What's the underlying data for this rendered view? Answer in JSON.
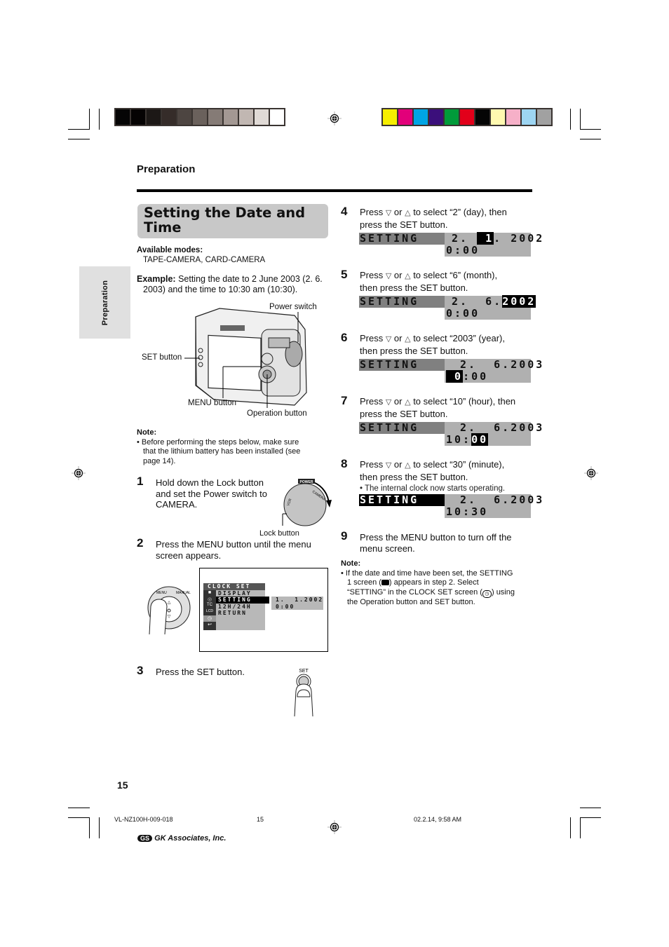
{
  "print_marks": {
    "grayscale_swatches": [
      "#050505",
      "#050303",
      "#1c1816",
      "#352c29",
      "#4d4541",
      "#6a615c",
      "#857b76",
      "#a39893",
      "#c1b7b2",
      "#e0dad6",
      "#ffffff"
    ],
    "color_swatches": [
      "#f6ee00",
      "#e2007a",
      "#00a5e5",
      "#3b0f7b",
      "#009b3a",
      "#e2001a",
      "#050505",
      "#fff9b0",
      "#f6b0c8",
      "#9dd5f2",
      "#a1a1a1"
    ]
  },
  "header": {
    "section": "Preparation",
    "side_tab": "Preparation"
  },
  "title": {
    "line1": "Setting the Date and",
    "line2": "Time"
  },
  "modes": {
    "label": "Available modes:",
    "value": "TAPE-CAMERA, CARD-CAMERA"
  },
  "example": {
    "label": "Example:",
    "line1": " Setting the date to 2 June 2003 (2. 6.",
    "line2": "2003) and the time to 10:30 am (10:30)."
  },
  "camera_figure": {
    "power_switch": "Power switch",
    "set_button": "SET button",
    "menu_button": "MENU button",
    "operation_button": "Operation button"
  },
  "note1": {
    "label": "Note:",
    "lines": [
      "• Before performing the steps below, make sure",
      "that the lithium battery has been installed (see",
      "page 14)."
    ]
  },
  "steps_left": [
    {
      "num": "1",
      "lines": [
        "Hold down the Lock button",
        "and set the Power switch to",
        "CAMERA."
      ]
    },
    {
      "num": "2",
      "lines": [
        "Press the MENU button until the menu",
        "screen appears."
      ]
    },
    {
      "num": "3",
      "lines": [
        "Press the SET button."
      ]
    }
  ],
  "dial_figure": {
    "power": "POWER",
    "camera": "CAMERA",
    "vcr": "VCR",
    "lock_button": "Lock button"
  },
  "menu_screen": {
    "title": "CLOCK SET",
    "items": [
      "DISPLAY",
      "SETTING",
      "12H/24H",
      "RETURN"
    ],
    "selected": "SETTING",
    "side_icons": [
      "camera-icon",
      "card-icon",
      "tc-icon",
      "lcd-icon",
      "clock-icon",
      "return-icon"
    ],
    "side_texts": [
      "",
      "",
      "TC",
      "LCD",
      "",
      ""
    ],
    "date": "1.  1.2002",
    "time": "0:00"
  },
  "hand_dial": {
    "menu": "MENU",
    "manual": "MANUAL"
  },
  "set_figure": {
    "label": "SET"
  },
  "steps_right": [
    {
      "num": "4",
      "pre": "Press ",
      "or": " or ",
      "post": " to select “2” (day), then",
      "line2": "press the SET button.",
      "bullet": "",
      "lcd": {
        "label": "SETTING",
        "label_highlight": false,
        "d1": "2. ",
        "d_hl": " 1",
        "d2": ". 2002",
        "t_pre": "0:00",
        "t_hl": "",
        "t_post": ""
      }
    },
    {
      "num": "5",
      "pre": "Press ",
      "or": " or ",
      "post": " to select “6” (month),",
      "line2": "then press the SET button.",
      "bullet": "",
      "lcd": {
        "label": "SETTING",
        "label_highlight": false,
        "d1": "2.  6.",
        "d_hl": "2002",
        "d2": "",
        "t_pre": "0:00",
        "t_hl": "",
        "t_post": ""
      }
    },
    {
      "num": "6",
      "pre": "Press ",
      "or": " or ",
      "post": " to select “2003” (year),",
      "line2": "then press the SET button.",
      "bullet": "",
      "lcd": {
        "label": "SETTING",
        "label_highlight": false,
        "d1": " 2.  6.2003",
        "d_hl": "",
        "d2": "",
        "t_pre": "",
        "t_hl": " 0",
        "t_post": ":00"
      }
    },
    {
      "num": "7",
      "pre": "Press ",
      "or": " or ",
      "post": " to select “10” (hour), then",
      "line2": "press the SET button.",
      "bullet": "",
      "lcd": {
        "label": "SETTING",
        "label_highlight": false,
        "d1": " 2.  6.2003",
        "d_hl": "",
        "d2": "",
        "t_pre": "10:",
        "t_hl": "00",
        "t_post": ""
      }
    },
    {
      "num": "8",
      "pre": "Press ",
      "or": " or ",
      "post": " to select “30” (minute),",
      "line2": "then press the SET button.",
      "bullet": "• The internal clock now starts operating.",
      "lcd": {
        "label": "SETTING",
        "label_highlight": true,
        "d1": " 2.  6.2003",
        "d_hl": "",
        "d2": "",
        "t_pre": "10:30",
        "t_hl": "",
        "t_post": ""
      }
    }
  ],
  "step9": {
    "num": "9",
    "lines": [
      "Press the MENU button to turn off the",
      "menu screen."
    ]
  },
  "note2": {
    "label": "Note:",
    "line1": "• If the date and time have been set, the SETTING",
    "line2a": "1 screen (",
    "line2b": ") appears in step 2. Select",
    "line3a": "“SETTING” in the CLOCK SET screen (",
    "line3b": ") using",
    "line4": "the Operation button and SET button."
  },
  "symbols": {
    "down": "▽",
    "up": "△"
  },
  "page_number": "15",
  "footer": {
    "doc_id": "VL-NZ100H-009-018",
    "page": "15",
    "timestamp": "02.2.14, 9:58 AM",
    "company": "GK Associates, Inc.",
    "logo": "GS"
  }
}
